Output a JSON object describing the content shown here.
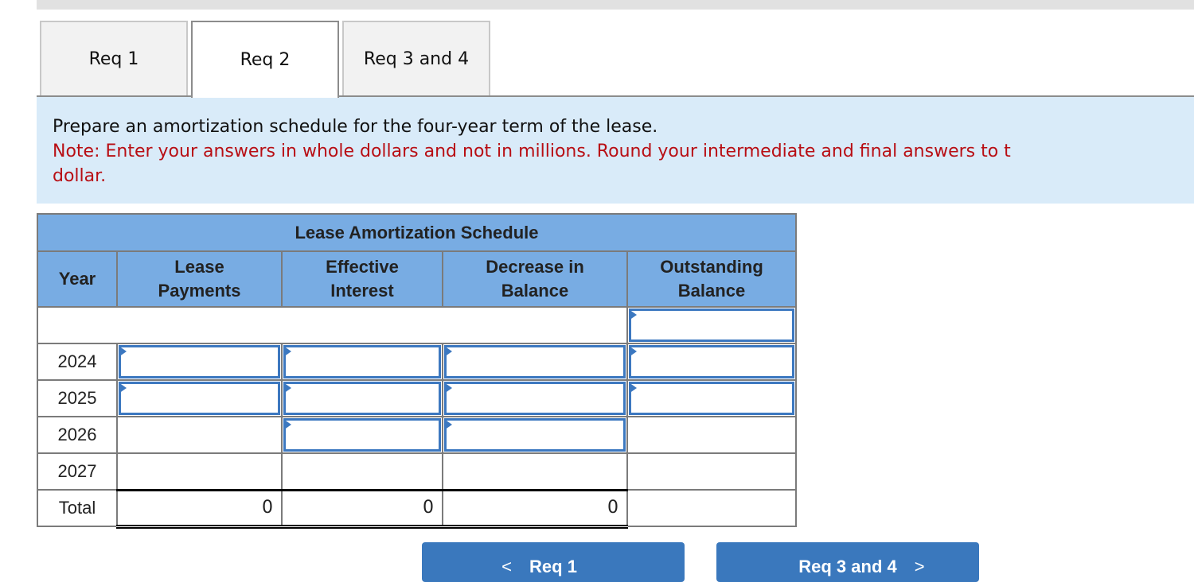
{
  "tabs": [
    {
      "label": "Req 1",
      "active": false
    },
    {
      "label": "Req 2",
      "active": true
    },
    {
      "label": "Req 3 and 4",
      "active": false
    }
  ],
  "instructions": {
    "main": "Prepare an amortization schedule for the four-year term of the lease.",
    "note_line1": "Note: Enter your answers in whole dollars and not in millions. Round your intermediate and final answers to t",
    "note_line2": "dollar."
  },
  "schedule": {
    "title": "Lease Amortization Schedule",
    "headers": {
      "year": "Year",
      "lease_payments": "Lease Payments",
      "effective_interest": "Effective Interest",
      "decrease_in_balance": "Decrease in Balance",
      "outstanding_balance": "Outstanding Balance"
    },
    "rows": [
      {
        "year": "",
        "lease_payments": null,
        "effective_interest": null,
        "decrease_in_balance": null,
        "outstanding_balance": ""
      },
      {
        "year": "2024",
        "lease_payments": "",
        "effective_interest": "",
        "decrease_in_balance": "",
        "outstanding_balance": ""
      },
      {
        "year": "2025",
        "lease_payments": "",
        "effective_interest": "",
        "decrease_in_balance": "",
        "outstanding_balance": ""
      },
      {
        "year": "2026",
        "lease_payments": null,
        "effective_interest": "",
        "decrease_in_balance": "",
        "outstanding_balance": null
      },
      {
        "year": "2027",
        "lease_payments": null,
        "effective_interest": null,
        "decrease_in_balance": null,
        "outstanding_balance": null
      }
    ],
    "total": {
      "label": "Total",
      "lease_payments": "0",
      "effective_interest": "0",
      "decrease_in_balance": "0"
    }
  },
  "nav": {
    "prev_label": "Req 1",
    "prev_icon": "chevron-left-icon",
    "prev_glyph": "<",
    "next_label": "Req 3 and 4",
    "next_icon": "chevron-right-icon",
    "next_glyph": ">"
  },
  "colors": {
    "header_bg": "#78ace3",
    "input_border": "#3c78c0",
    "note_text": "#b80e14",
    "instructions_bg": "#d9ebf9",
    "button_bg": "#3a78bd"
  }
}
